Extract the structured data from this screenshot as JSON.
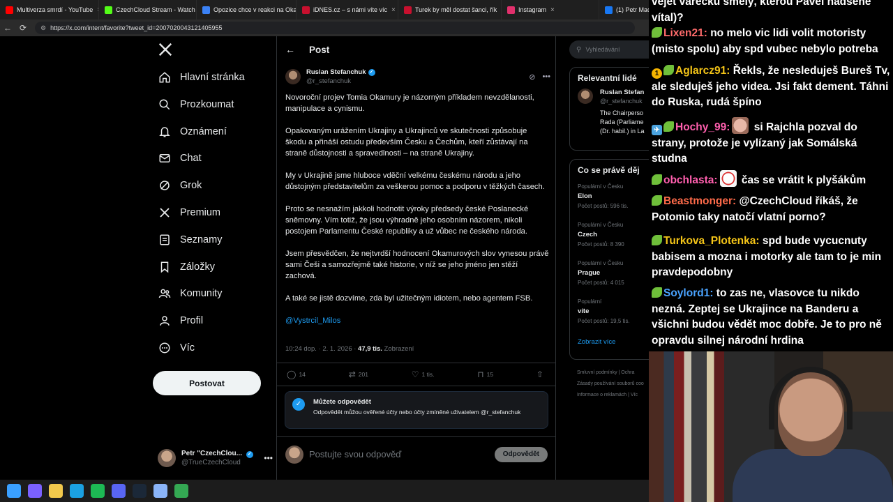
{
  "browser": {
    "tabs": [
      {
        "label": "Multiverza smrdí - YouTube",
        "color": "#ff0000"
      },
      {
        "label": "CzechCloud Stream - Watch",
        "color": "#53fc18"
      },
      {
        "label": "Opozice chce v reakci na Oka",
        "color": "#3b82f6"
      },
      {
        "label": "iDNES.cz – s námi víte víc",
        "color": "#c8102e"
      },
      {
        "label": "Turek by měl dostat šanci, řík",
        "color": "#c8102e"
      },
      {
        "label": "Instagram",
        "color": "#e1306c"
      },
      {
        "label": "(1) Petr Macink",
        "color": "#1877f2"
      }
    ],
    "url": "https://x.com/intent/favorite?tweet_id=2007020043121405955"
  },
  "sidebar": {
    "items": [
      {
        "label": "Hlavní stránka",
        "icon": "home-icon"
      },
      {
        "label": "Prozkoumat",
        "icon": "search-icon"
      },
      {
        "label": "Oznámení",
        "icon": "bell-icon"
      },
      {
        "label": "Chat",
        "icon": "mail-icon"
      },
      {
        "label": "Grok",
        "icon": "grok-icon"
      },
      {
        "label": "Premium",
        "icon": "x-icon"
      },
      {
        "label": "Seznamy",
        "icon": "list-icon"
      },
      {
        "label": "Záložky",
        "icon": "bookmark-icon"
      },
      {
        "label": "Komunity",
        "icon": "people-icon"
      },
      {
        "label": "Profil",
        "icon": "user-icon"
      },
      {
        "label": "Víc",
        "icon": "more-icon"
      }
    ],
    "post_label": "Postovat",
    "account": {
      "name": "Petr \"CzechClou...",
      "handle": "@TrueCzechCloud"
    }
  },
  "post": {
    "header": "Post",
    "author_name": "Ruslan Stefanchuk",
    "author_handle": "@r_stefanchuk",
    "paragraphs": [
      "Novoroční projev Tomia Okamury je názorným příkladem nevzdělanosti, manipulace a cynismu.",
      "Opakovaným urážením Ukrajiny a Ukrajinců ve skutečnosti způsobuje škodu a přináší ostudu především Česku a Čechům, kteří zůstávají na straně důstojnosti a spravedlnosti – na straně Ukrajiny.",
      "My v Ukrajině jsme hluboce vděční velkému českému národu a jeho důstojným představitelům za veškerou pomoc a podporu v těžkých časech.",
      "Proto se nesnažím jakkoli hodnotit výroky předsedy české Poslanecké sněmovny. Vím totiž, že jsou výhradně jeho osobním názorem, nikoli postojem Parlamentu České republiky a už vůbec ne českého národa.",
      "Jsem přesvědčen, že nejtvrdší hodnocení Okamurových slov vynesou právě sami Češi a samozřejmě také historie, v níž se jeho jméno jen stěží zachová.",
      "A také se jistě dozvíme, zda byl užitečným idiotem, nebo agentem FSB."
    ],
    "mention": "@Vystrcil_Milos",
    "time": "10:24 dop. · 2. 1. 2026 · ",
    "views_count": "47,9 tis.",
    "views_label": " Zobrazení",
    "stats": {
      "replies": "14",
      "reposts": "201",
      "likes": "1 tis.",
      "bookmarks": "15"
    },
    "reply_notice": {
      "title": "Můžete odpovědět",
      "text": "Odpovědět můžou ověřené účty nebo účty zmíněné uživatelem @r_stefanchuk"
    },
    "compose_placeholder": "Postujte svou odpověď",
    "reply_button": "Odpovědět"
  },
  "right": {
    "search_placeholder": "Vyhledávání",
    "related_title": "Relevantní lidé",
    "related_person": {
      "name": "Ruslan Stefan",
      "handle": "@r_stefanchuk",
      "bio1": "The Chairperso",
      "bio2": "Rada (Parliame",
      "bio3": "(Dr. habil.) in La"
    },
    "trends_title": "Co se právě děj",
    "trends": [
      {
        "context": "Populární v Česku",
        "title": "Elon",
        "count": "Počet postů: 596 tis."
      },
      {
        "context": "Populární v Česku",
        "title": "Czech",
        "count": "Počet postů: 8 390"
      },
      {
        "context": "Populární v Česku",
        "title": "Prague",
        "count": "Počet postů: 4 015"
      },
      {
        "context": "Populární",
        "title": "víte",
        "count": "Počet postů: 19,5 tis."
      }
    ],
    "show_more": "Zobrazit více",
    "footer": [
      "Smluvní podmínky  |  Ochra",
      "Zásady používání souborů coo",
      "Informace o reklamách  |  Víc"
    ]
  },
  "chat": {
    "messages": [
      {
        "user": "",
        "text": "vejet vařečku smělý, kterou Pavel nadšeně vítal)?",
        "color": "#ffffff"
      },
      {
        "user": "Lixen21:",
        "text": " no melo vic lidi volit motoristy (misto spolu) aby spd vubec nebylo potreba",
        "color": "#ff6b6b"
      },
      {
        "user": "Aglarcz91:",
        "text": " Řekls, že nesleduješ Bureš Tv, ale sleduješ jeho videa. Jsi fakt dement. Táhni do Ruska, rudá špíno",
        "color": "#f5c518"
      },
      {
        "user": "Hochy_99:",
        "text": " si Rajchla pozval do strany, protože je vylízaný jak Somálská studna",
        "color": "#ff5fae"
      },
      {
        "user": "obchlasta:",
        "text": " čas se vrátit k plyšákům",
        "color": "#ff5fae"
      },
      {
        "user": "Beastmonger:",
        "text": " @CzechCloud říkáš, že Potomio taky natočí vlatní porno?",
        "color": "#ff6b4a"
      },
      {
        "user": "Turkova_Plotenka:",
        "text": " spd bude vycucnuty babisem a mozna i motorky ale tam to je min pravdepodobny",
        "color": "#f5c518"
      },
      {
        "user": "Soylord1:",
        "text": " to zas ne, vlasovce tu nikdo nezná. Zeptej se Ukrajince na Banderu a všichni budou vědět moc dobře. Je to pro ně opravdu silnej národní hrdina",
        "color": "#4aa3ff"
      }
    ],
    "badge_num": "1"
  },
  "taskbar": {
    "apps": [
      {
        "name": "windows-start-icon",
        "color": "#3aa0ff"
      },
      {
        "name": "copilot-icon",
        "color": "#7b61ff"
      },
      {
        "name": "file-explorer-icon",
        "color": "#f2c94c"
      },
      {
        "name": "edge-icon",
        "color": "#1ba1e2"
      },
      {
        "name": "spotify-icon",
        "color": "#1db954"
      },
      {
        "name": "discord-icon",
        "color": "#5865f2"
      },
      {
        "name": "steam-icon",
        "color": "#1b2838"
      },
      {
        "name": "notepad-icon",
        "color": "#8ab4f8"
      },
      {
        "name": "app-icon",
        "color": "#34a853"
      }
    ]
  }
}
